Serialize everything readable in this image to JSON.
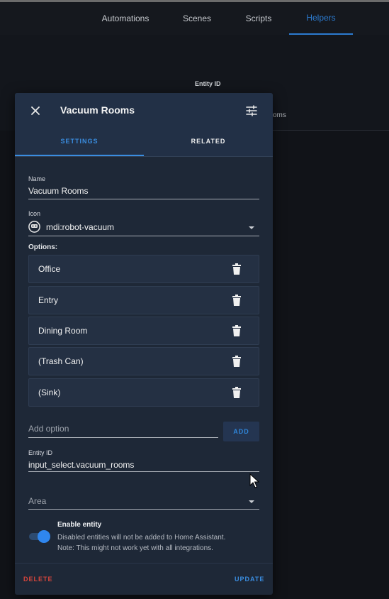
{
  "app": {
    "tabs": [
      {
        "label": "Automations"
      },
      {
        "label": "Scenes"
      },
      {
        "label": "Scripts"
      },
      {
        "label": "Helpers"
      }
    ],
    "table": {
      "entity_id_header": "Entity ID",
      "row_fragment": "oms"
    }
  },
  "dialog": {
    "title": "Vacuum Rooms",
    "tabs": {
      "settings": "SETTINGS",
      "related": "RELATED"
    },
    "name": {
      "label": "Name",
      "value": "Vacuum Rooms"
    },
    "icon": {
      "label": "Icon",
      "value": "mdi:robot-vacuum",
      "icon_name": "robot-vacuum-icon"
    },
    "options_label": "Options:",
    "options": [
      {
        "label": "Office"
      },
      {
        "label": "Entry"
      },
      {
        "label": "Dining Room"
      },
      {
        "label": "(Trash Can)"
      },
      {
        "label": "(Sink)"
      }
    ],
    "add_option": {
      "placeholder": "Add option",
      "button": "ADD"
    },
    "entity_id": {
      "label": "Entity ID",
      "value": "input_select.vacuum_rooms"
    },
    "area": {
      "placeholder": "Area"
    },
    "enable_entity": {
      "title": "Enable entity",
      "enabled": true,
      "description_line1": "Disabled entities will not be added to Home Assistant.",
      "description_line2": "Note: This might not work yet with all integrations."
    },
    "footer": {
      "delete": "DELETE",
      "update": "UPDATE"
    }
  },
  "colors": {
    "accent": "#3a8de0",
    "danger": "#d6453c",
    "dialog_bg": "#1e2837",
    "toggle_on": "#2f86ee"
  }
}
